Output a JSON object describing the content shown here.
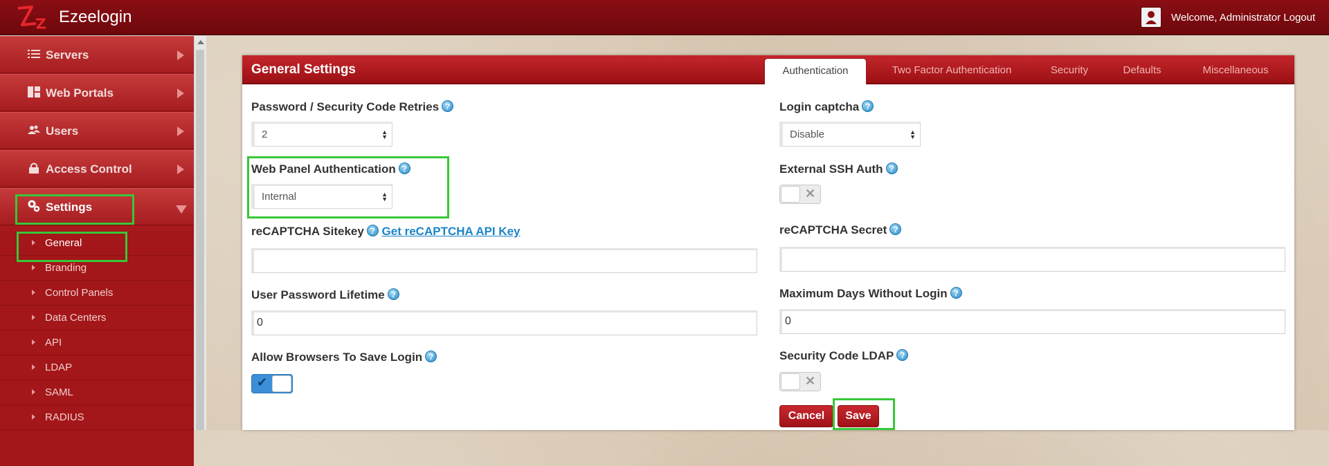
{
  "app": {
    "brand": "Ezeelogin",
    "welcome_text": "Welcome, Administrator",
    "logout_label": "Logout"
  },
  "sidebar": {
    "items": [
      {
        "label": "Servers",
        "icon": "list-icon"
      },
      {
        "label": "Web Portals",
        "icon": "dashboard-icon"
      },
      {
        "label": "Users",
        "icon": "users-icon"
      },
      {
        "label": "Access Control",
        "icon": "lock-icon"
      },
      {
        "label": "Settings",
        "icon": "gears-icon",
        "active": true
      }
    ],
    "sub_items": [
      {
        "label": "General",
        "active": true
      },
      {
        "label": "Branding"
      },
      {
        "label": "Control Panels"
      },
      {
        "label": "Data Centers"
      },
      {
        "label": "API"
      },
      {
        "label": "LDAP"
      },
      {
        "label": "SAML"
      },
      {
        "label": "RADIUS"
      }
    ]
  },
  "panel": {
    "title": "General Settings",
    "tabs": [
      {
        "label": "Authentication",
        "active": true
      },
      {
        "label": "Two Factor Authentication"
      },
      {
        "label": "Security"
      },
      {
        "label": "Defaults"
      },
      {
        "label": "Miscellaneous"
      }
    ]
  },
  "form": {
    "password_retries": {
      "label": "Password / Security Code Retries",
      "value": "2"
    },
    "login_captcha": {
      "label": "Login captcha",
      "value": "Disable"
    },
    "web_panel_auth": {
      "label": "Web Panel Authentication",
      "value": "Internal"
    },
    "external_ssh_auth": {
      "label": "External SSH Auth",
      "enabled": false
    },
    "recaptcha_sitekey": {
      "label": "reCAPTCHA Sitekey",
      "link": "Get reCAPTCHA API Key",
      "value": ""
    },
    "recaptcha_secret": {
      "label": "reCAPTCHA Secret",
      "value": ""
    },
    "user_password_lifetime": {
      "label": "User Password Lifetime",
      "value": "0"
    },
    "max_days_without_login": {
      "label": "Maximum Days Without Login",
      "value": "0"
    },
    "allow_browsers_save_login": {
      "label": "Allow Browsers To Save Login",
      "enabled": true
    },
    "security_code_ldap": {
      "label": "Security Code LDAP",
      "enabled": false
    },
    "cancel_label": "Cancel",
    "save_label": "Save"
  },
  "colors": {
    "topbar": "#7a0a0f",
    "sidebar": "#a8191d",
    "accent_red": "#b01c21",
    "highlight_green": "#38c738",
    "help_blue": "#2a8fcc",
    "toggle_on_blue": "#3b8fd6"
  }
}
